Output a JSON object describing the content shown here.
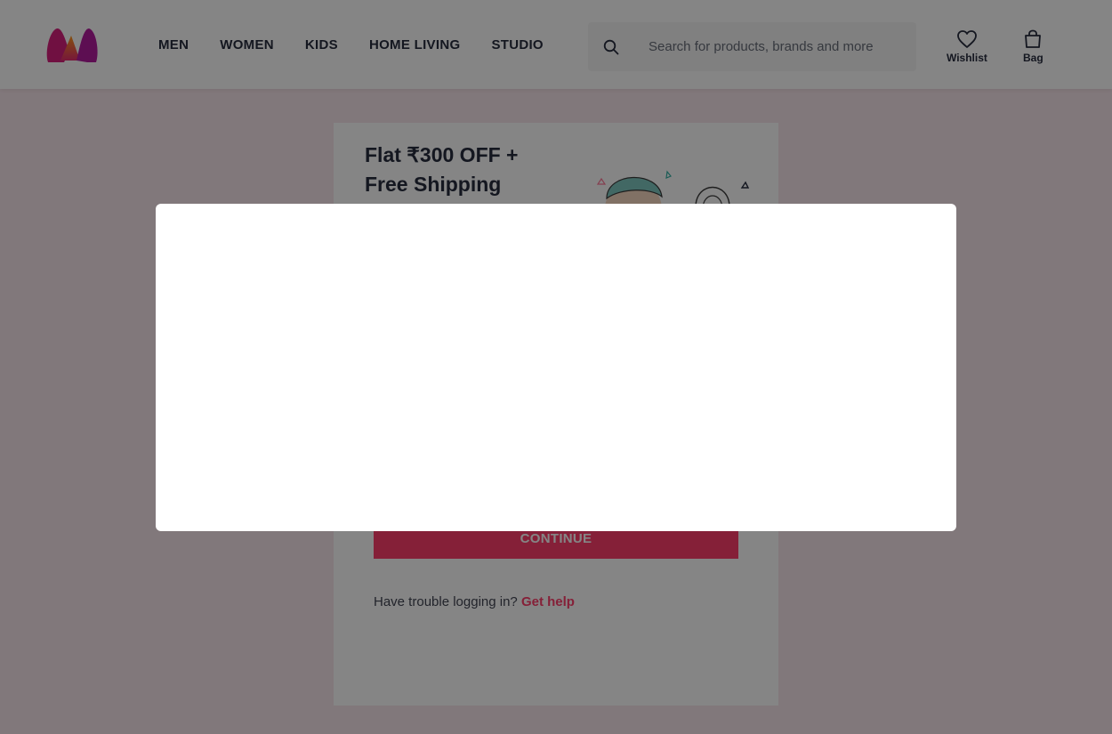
{
  "header": {
    "nav": [
      "MEN",
      "WOMEN",
      "KIDS",
      "HOME LIVING",
      "STUDIO"
    ],
    "search_placeholder": "Search for products, brands and more",
    "wishlist_label": "Wishlist",
    "bag_label": "Bag",
    "logo_icon": "myntra-logo-icon"
  },
  "promo": {
    "line1": "Flat ₹300 OFF +",
    "line2": "Free Shipping"
  },
  "login": {
    "continue_label": "CONTINUE",
    "trouble_text": "Have trouble logging in? ",
    "help_link": "Get help"
  },
  "colors": {
    "brand_pink": "#ff3f6c",
    "text_dark": "#282c3f"
  }
}
